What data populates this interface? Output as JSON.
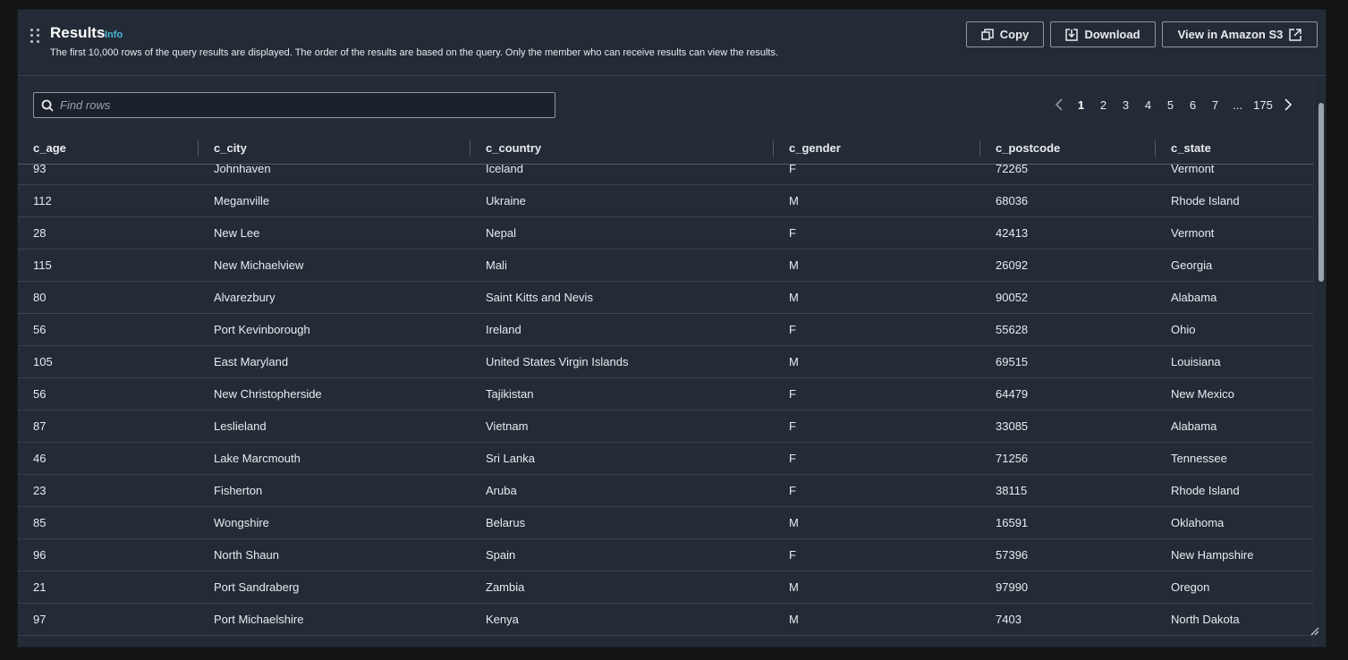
{
  "header": {
    "title": "Results",
    "info_label": "Info",
    "description": "The first 10,000 rows of the query results are displayed. The order of the results are based on the query. Only the member who can receive results can view the results.",
    "copy_label": "Copy",
    "download_label": "Download",
    "s3_label": "View in Amazon S3"
  },
  "search": {
    "placeholder": "Find rows"
  },
  "pagination": {
    "current_page": "1",
    "pages": [
      "2",
      "3",
      "4",
      "5",
      "6",
      "7"
    ],
    "ellipsis": "...",
    "last_page": "175"
  },
  "table": {
    "columns": [
      "c_age",
      "c_city",
      "c_country",
      "c_gender",
      "c_postcode",
      "c_state"
    ],
    "rows": [
      [
        "93",
        "Johnhaven",
        "Iceland",
        "F",
        "72265",
        "Vermont"
      ],
      [
        "112",
        "Meganville",
        "Ukraine",
        "M",
        "68036",
        "Rhode Island"
      ],
      [
        "28",
        "New Lee",
        "Nepal",
        "F",
        "42413",
        "Vermont"
      ],
      [
        "115",
        "New Michaelview",
        "Mali",
        "M",
        "26092",
        "Georgia"
      ],
      [
        "80",
        "Alvarezbury",
        "Saint Kitts and Nevis",
        "M",
        "90052",
        "Alabama"
      ],
      [
        "56",
        "Port Kevinborough",
        "Ireland",
        "F",
        "55628",
        "Ohio"
      ],
      [
        "105",
        "East Maryland",
        "United States Virgin Islands",
        "M",
        "69515",
        "Louisiana"
      ],
      [
        "56",
        "New Christopherside",
        "Tajikistan",
        "F",
        "64479",
        "New Mexico"
      ],
      [
        "87",
        "Leslieland",
        "Vietnam",
        "F",
        "33085",
        "Alabama"
      ],
      [
        "46",
        "Lake Marcmouth",
        "Sri Lanka",
        "F",
        "71256",
        "Tennessee"
      ],
      [
        "23",
        "Fisherton",
        "Aruba",
        "F",
        "38115",
        "Rhode Island"
      ],
      [
        "85",
        "Wongshire",
        "Belarus",
        "M",
        "16591",
        "Oklahoma"
      ],
      [
        "96",
        "North Shaun",
        "Spain",
        "F",
        "57396",
        "New Hampshire"
      ],
      [
        "21",
        "Port Sandraberg",
        "Zambia",
        "M",
        "97990",
        "Oregon"
      ],
      [
        "97",
        "Port Michaelshire",
        "Kenya",
        "M",
        "7403",
        "North Dakota"
      ]
    ]
  },
  "icons": {
    "drag": "drag-handle-icon",
    "copy": "copy-icon",
    "download": "download-icon",
    "external": "external-link-icon",
    "search": "search-icon",
    "prev": "chevron-left-icon",
    "next": "chevron-right-icon"
  },
  "colors": {
    "background": "#131313",
    "panel": "#232b37",
    "accent_info": "#44b9d6",
    "text": "#e9ebed"
  }
}
